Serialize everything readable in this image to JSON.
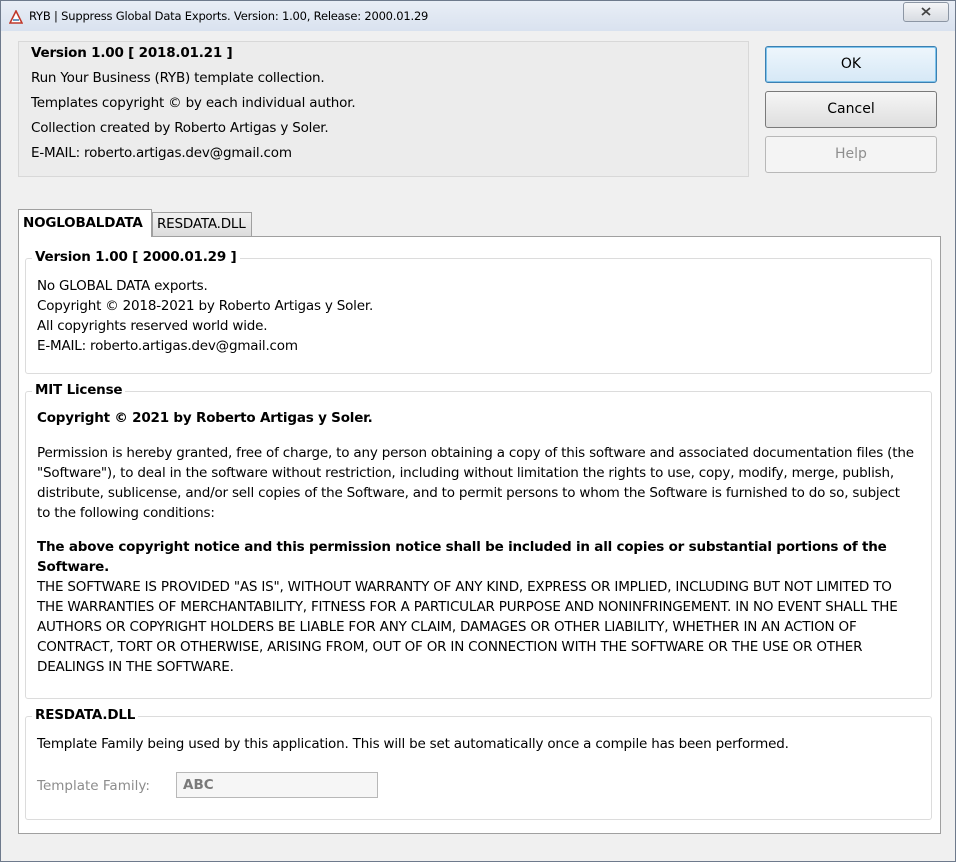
{
  "window": {
    "title": "RYB | Suppress Global Data Exports. Version: 1.00, Release: 2000.01.29",
    "close_icon": "close-icon"
  },
  "info": {
    "version": "Version 1.00 [ 2018.01.21 ]",
    "line1": "Run Your Business (RYB) template collection.",
    "line2": "Templates copyright © by each individual author.",
    "line3": "Collection created by Roberto Artigas y Soler.",
    "line4": "E-MAIL: roberto.artigas.dev@gmail.com"
  },
  "buttons": {
    "ok": "OK",
    "cancel": "Cancel",
    "help": "Help"
  },
  "tabs": [
    {
      "label": "NOGLOBALDATA",
      "active": true
    },
    {
      "label": "RESDATA.DLL",
      "active": false
    }
  ],
  "version_group": {
    "title": "Version 1.00 [ 2000.01.29 ]",
    "lines": [
      "No GLOBAL DATA exports.",
      "Copyright © 2018-2021 by Roberto Artigas y Soler.",
      "All copyrights reserved world wide.",
      "E-MAIL: roberto.artigas.dev@gmail.com"
    ]
  },
  "license_group": {
    "title": "MIT License",
    "copyright": "Copyright © 2021 by Roberto Artigas y Soler.",
    "permission": "Permission is hereby granted, free of charge, to any person obtaining a copy of this software and associated documentation files (the \"Software\"), to deal in the software without restriction, including without limitation the rights to use, copy, modify, merge, publish, distribute, sublicense, and/or sell copies of the Software, and to permit persons to whom the Software is furnished to do so, subject to the following conditions:",
    "notice": "The above copyright notice and this permission notice shall be included in all copies or substantial portions of the Software.",
    "disclaimer": "THE SOFTWARE IS PROVIDED \"AS IS\", WITHOUT WARRANTY OF ANY KIND, EXPRESS OR IMPLIED, INCLUDING BUT NOT LIMITED TO THE WARRANTIES OF MERCHANTABILITY, FITNESS FOR A PARTICULAR PURPOSE AND NONINFRINGEMENT. IN NO EVENT SHALL THE AUTHORS OR COPYRIGHT HOLDERS BE LIABLE FOR ANY CLAIM, DAMAGES OR OTHER LIABILITY, WHETHER IN AN ACTION OF CONTRACT, TORT OR OTHERWISE, ARISING FROM, OUT OF OR IN CONNECTION WITH THE SOFTWARE OR THE USE OR OTHER DEALINGS IN THE SOFTWARE."
  },
  "resdata_group": {
    "title": "RESDATA.DLL",
    "description": "Template Family being used by this application. This will be set automatically once a compile has been performed.",
    "family_label": "Template Family:",
    "family_value": "ABC"
  },
  "colors": {
    "accent": "#3c7fb1",
    "disabled_text": "#8c8c8c"
  }
}
